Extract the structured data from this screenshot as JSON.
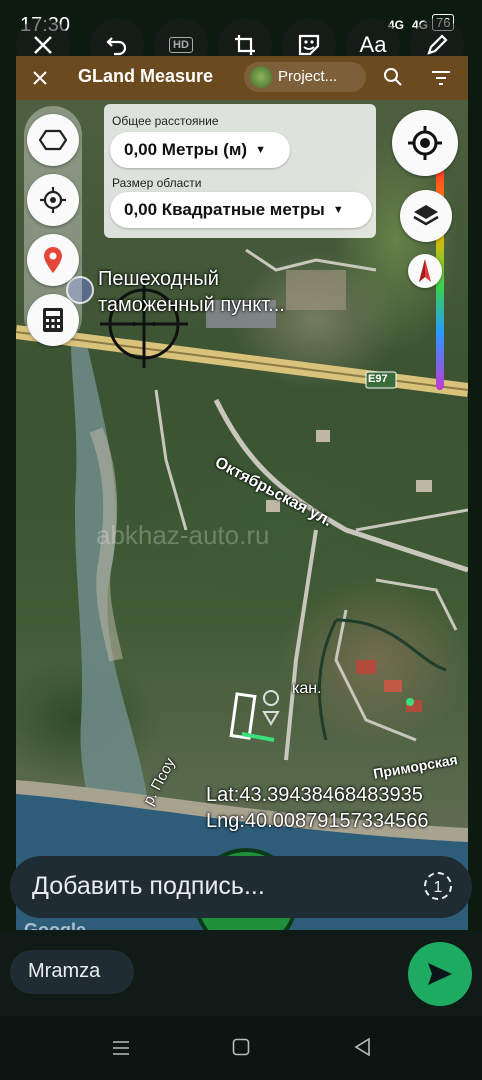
{
  "status_bar": {
    "time": "17:30",
    "network_1": "4G",
    "network_2": "4G",
    "battery": "76"
  },
  "editor_toolbar": {
    "text_tool_label": "Aa",
    "hd_label": "HD"
  },
  "app_bar": {
    "title": "GLand Measure",
    "project_label": "Project..."
  },
  "measure_panel": {
    "distance_label": "Общее расстояние",
    "distance_value": "0,00 Метры (м)",
    "area_label": "Размер области",
    "area_value": "0,00 Квадратные метры"
  },
  "map": {
    "poi_line_1": "Пешеходный",
    "poi_line_2": "таможенный пункт...",
    "road_badge": "E97",
    "street_1": "Октябрьская ул.",
    "street_2": "Приморская",
    "river": "р. Псоу",
    "canal": "кан.",
    "watermark": "abkhaz-auto.ru",
    "google": "Google"
  },
  "coordinates": {
    "lat": "Lat:43.39438468483935",
    "lng": "Lng:40.00879157334566"
  },
  "caption": {
    "placeholder": "Добавить подпись...",
    "view_once": "1"
  },
  "recipient": {
    "name": "Mramza"
  },
  "colors": {
    "send_green": "#1daa61",
    "caption_bg": "#1f2c33",
    "app_bar": "#6b4a1f"
  }
}
